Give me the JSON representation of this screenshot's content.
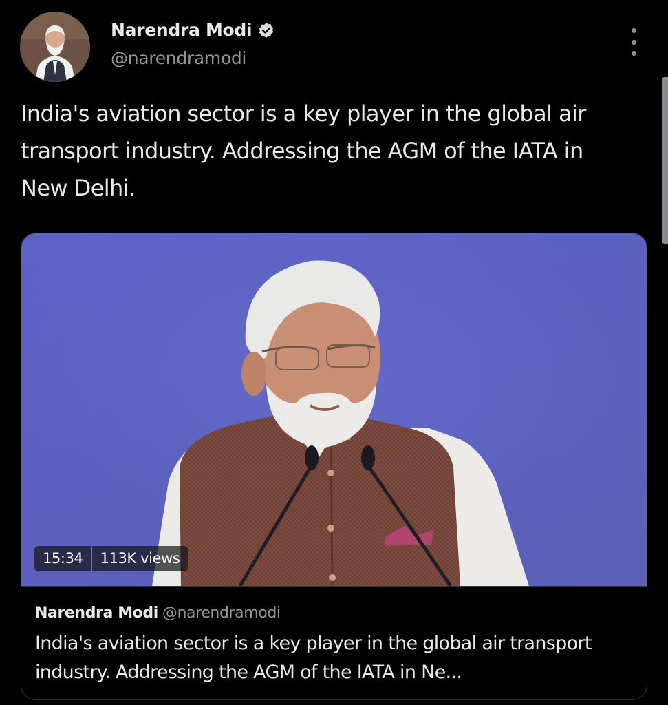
{
  "post": {
    "author_name": "Narendra Modi",
    "author_handle": "@narendramodi",
    "verified_icon": "verified-badge-icon",
    "more_icon": "more-vertical-icon",
    "text": "India's aviation sector is a key player in the global air transport industry. Addressing the AGM of the IATA in New Delhi."
  },
  "media": {
    "duration": "15:34",
    "views": "113K views"
  },
  "link_card": {
    "author_name": "Narendra Modi",
    "author_handle": "@narendramodi",
    "text": "India's aviation sector is a key player in the global air transport industry. Addressing the AGM of the IATA in Ne..."
  },
  "colors": {
    "background": "#000000",
    "text_primary": "#e7e9ea",
    "text_secondary": "#8f959a",
    "border": "#2f3336",
    "video_backdrop": "#5b63c6"
  }
}
